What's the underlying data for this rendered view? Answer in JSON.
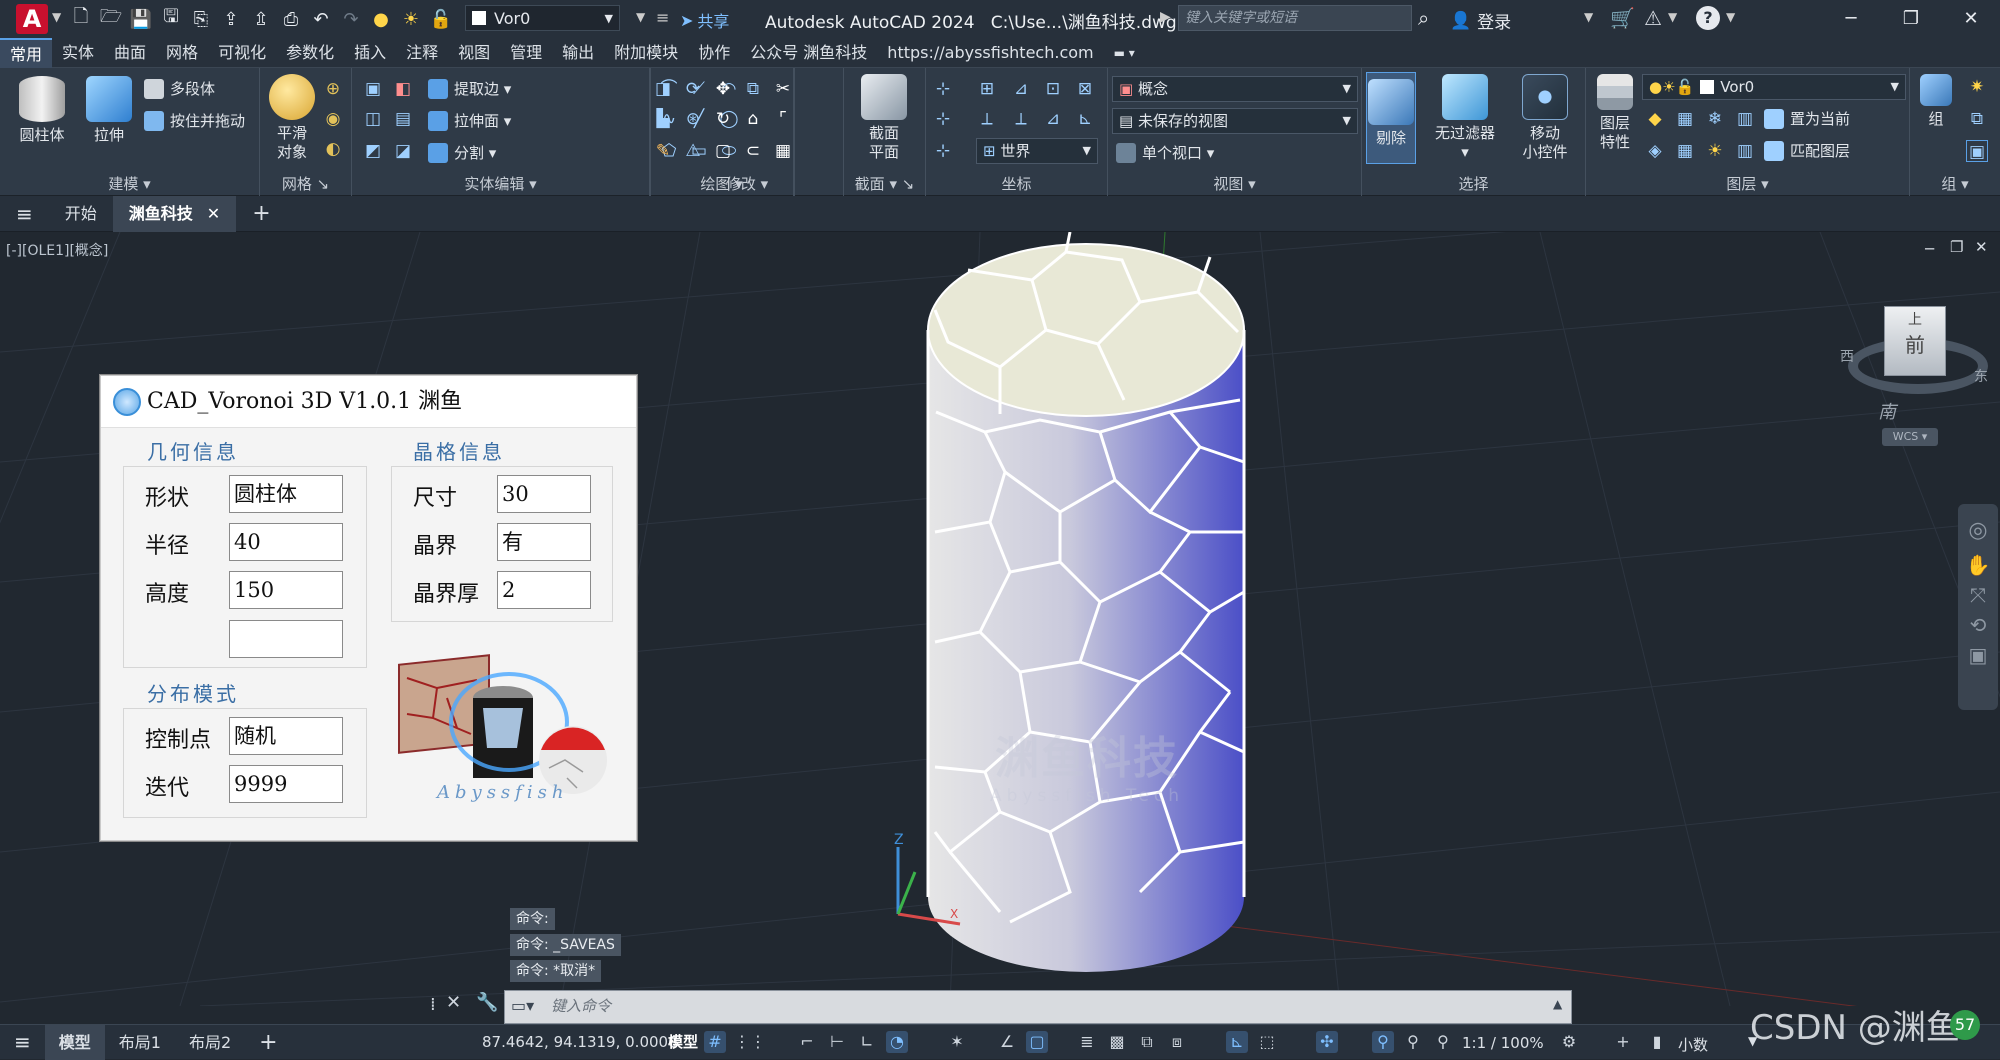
{
  "app": {
    "logo": "A",
    "title": "Autodesk AutoCAD 2024",
    "file_path": "C:\\Use...\\渊鱼科技.dwg",
    "share_label": "共享",
    "search_placeholder": "键入关键字或短语",
    "login_label": "登录",
    "layer_name": "Vor0"
  },
  "ribbon_tabs": [
    "常用",
    "实体",
    "曲面",
    "网格",
    "可视化",
    "参数化",
    "插入",
    "注释",
    "视图",
    "管理",
    "输出",
    "附加模块",
    "协作",
    "公众号 渊鱼科技",
    "https://abyssfishtech.com"
  ],
  "ribbon": {
    "modeling": {
      "title": "建模",
      "cylinder": "圆柱体",
      "extrude": "拉伸",
      "polysolid": "多段体",
      "presspull": "按住并拖动"
    },
    "mesh": {
      "title": "网格",
      "smooth": "平滑",
      "smooth2": "对象"
    },
    "solid_edit": {
      "title": "实体编辑",
      "extract_edges": "提取边",
      "extrude_faces": "拉伸面",
      "separate": "分割"
    },
    "draw": {
      "title": "绘图"
    },
    "modify": {
      "title": "修改"
    },
    "section": {
      "title": "截面",
      "plane": "截面",
      "plane2": "平面"
    },
    "coordinates": {
      "title": "坐标",
      "world": "世界"
    },
    "view": {
      "title": "视图",
      "visual_style": "概念",
      "saved_view": "未保存的视图",
      "viewport": "单个视口"
    },
    "selection": {
      "title": "选择",
      "cull": "剔除",
      "no_filter": "无过滤器",
      "gizmo": "移动",
      "gizmo2": "小控件"
    },
    "layers": {
      "title": "图层",
      "props": "图层",
      "props2": "特性",
      "layer_dd": "Vor0",
      "set_current": "置为当前",
      "match_layer": "匹配图层"
    },
    "groups": {
      "title": "组",
      "group": "组"
    }
  },
  "file_tabs": {
    "start": "开始",
    "current": "渊鱼科技"
  },
  "viewport": {
    "label": "[-][OLE1][概念]",
    "viewcube": {
      "top": "上",
      "front": "前",
      "west": "西",
      "east": "东",
      "south": "南",
      "wcs": "WCS"
    },
    "watermark_cn": "渊鱼科技",
    "watermark_en": "Abyssfish Tech"
  },
  "dialog": {
    "title": "CAD_Voronoi 3D V1.0.1 渊鱼",
    "geometry_group": "几何信息",
    "crystal_group": "晶格信息",
    "distribution_group": "分布模式",
    "shape_label": "形状",
    "shape_value": "圆柱体",
    "radius_label": "半径",
    "radius_value": "40",
    "height_label": "高度",
    "height_value": "150",
    "extra_value": "",
    "size_label": "尺寸",
    "size_value": "30",
    "boundary_label": "晶界",
    "boundary_value": "有",
    "thickness_label": "晶界厚",
    "thickness_value": "2",
    "control_label": "控制点",
    "control_value": "随机",
    "iter_label": "迭代",
    "iter_value": "9999",
    "logo_text": "Abyssfish"
  },
  "command": {
    "history": [
      "命令:",
      "命令: _SAVEAS",
      "命令: *取消*"
    ],
    "placeholder": "键入命令"
  },
  "status": {
    "tabs": [
      "模型",
      "布局1",
      "布局2"
    ],
    "coords": "87.4642, 94.1319, 0.0000",
    "model": "模型",
    "scale": "1:1 / 100%",
    "units": "小数",
    "csdn": "CSDN @渊鱼"
  },
  "colors": {
    "accent": "#5aa0e6",
    "ribbon_bg": "#2f3a47",
    "viewport_bg": "#212830"
  }
}
